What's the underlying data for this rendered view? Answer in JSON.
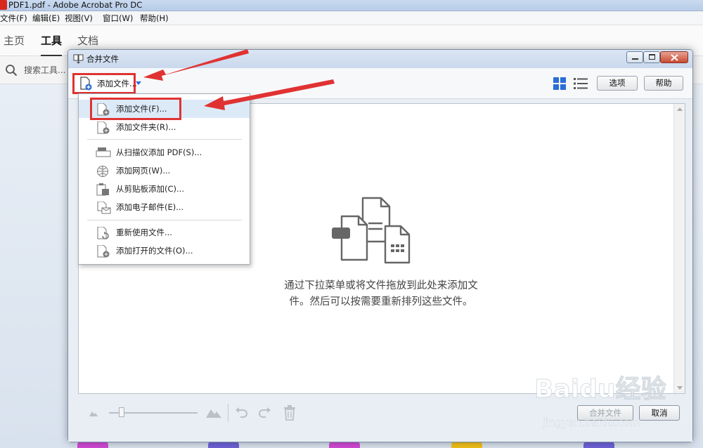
{
  "window": {
    "title": "PDF1.pdf - Adobe Acrobat Pro DC"
  },
  "menubar": [
    {
      "label": "文件(F)"
    },
    {
      "label": "编辑(E)"
    },
    {
      "label": "视图(V)"
    },
    {
      "label": "窗口(W)"
    },
    {
      "label": "帮助(H)"
    }
  ],
  "tabs": [
    {
      "label": "主页",
      "active": false
    },
    {
      "label": "工具",
      "active": true
    },
    {
      "label": "文档",
      "active": false
    }
  ],
  "search": {
    "placeholder": "搜索工具..."
  },
  "dialog": {
    "title": "合并文件",
    "add_files_label": "添加文件...",
    "options_label": "选项",
    "help_label": "帮助",
    "hint_line1": "通过下拉菜单或将文件拖放到此处来添加文",
    "hint_line2": "件。然后可以按需要重新排列这些文件。",
    "combine_label": "合并文件",
    "cancel_label": "取消"
  },
  "dropdown": [
    {
      "label": "添加文件(F)...",
      "icon": "add-file-icon",
      "highlighted": true
    },
    {
      "label": "添加文件夹(R)...",
      "icon": "add-folder-icon"
    },
    {
      "label": "从扫描仪添加 PDF(S)...",
      "icon": "scanner-icon"
    },
    {
      "label": "添加网页(W)...",
      "icon": "globe-icon"
    },
    {
      "label": "从剪贴板添加(C)...",
      "icon": "clipboard-icon"
    },
    {
      "label": "添加电子邮件(E)...",
      "icon": "email-icon"
    },
    {
      "label": "重新使用文件...",
      "icon": "reuse-file-icon"
    },
    {
      "label": "添加打开的文件(O)...",
      "icon": "add-open-file-icon"
    }
  ],
  "watermark": {
    "brand": "Baidu经验",
    "url": "jingyan.baidu.com"
  },
  "colors": {
    "annotation_red": "#e03232",
    "accent_blue": "#2a6ed6"
  }
}
